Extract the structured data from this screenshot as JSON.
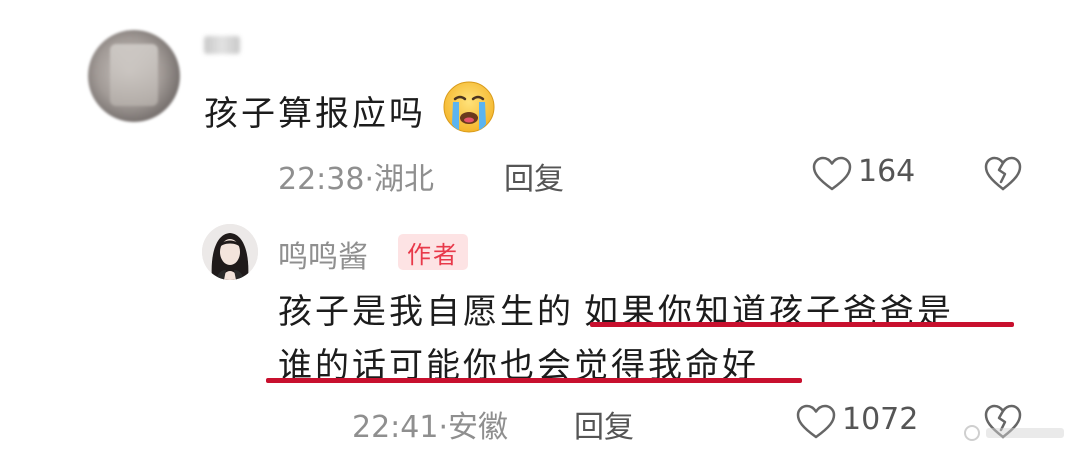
{
  "comments": [
    {
      "text": "孩子算报应吗",
      "emoji_name": "crying-face-emoji",
      "time": "22:38",
      "separator": "·",
      "location": "湖北",
      "reply_label": "回复",
      "likes": "164"
    }
  ],
  "reply": {
    "username": "鸣鸣酱",
    "badge": "作者",
    "text_line1_part1": "孩子是我自愿生的",
    "text_line1_part2": "如果你知道孩子爸爸是",
    "text_line2": "谁的话可能你也会觉得我命好",
    "time": "22:41",
    "separator": "·",
    "location": "安徽",
    "reply_label": "回复",
    "likes": "1072"
  },
  "colors": {
    "underline": "#c8102e",
    "badge_text": "#e8394a",
    "badge_bg": "#fde3e4"
  },
  "icons": [
    "heart-outline-icon",
    "broken-heart-icon",
    "crying-face-emoji",
    "avatar-image"
  ]
}
